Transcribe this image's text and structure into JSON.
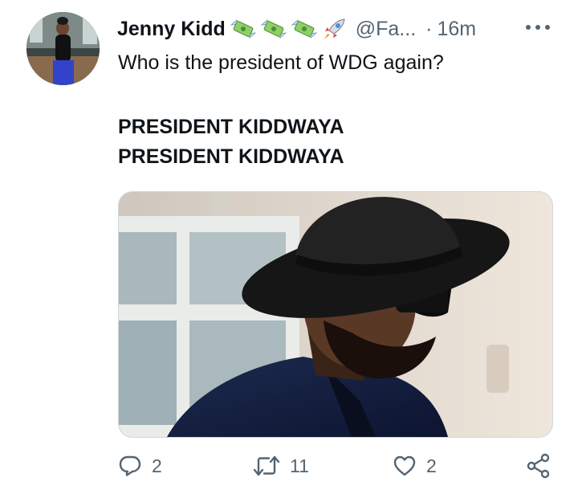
{
  "tweet": {
    "author": {
      "name": "Jenny Kidd",
      "name_emojis": [
        "money-with-wings-emoji",
        "money-with-wings-emoji",
        "money-with-wings-emoji",
        "rocket-emoji"
      ],
      "handle": "@Fa...",
      "separator": "·",
      "time": "16m"
    },
    "lines": [
      "Who is the president of WDG again?",
      "PRESIDENT KIDDWAYA",
      "PRESIDENT KIDDWAYA"
    ],
    "media_icon": "photo-man-black-fedora-sunglasses",
    "actions": {
      "reply_count": "2",
      "retweet_count": "11",
      "like_count": "2"
    },
    "colors": {
      "text_primary": "#0f1419",
      "text_secondary": "#536471",
      "border": "#cfd9de"
    }
  }
}
